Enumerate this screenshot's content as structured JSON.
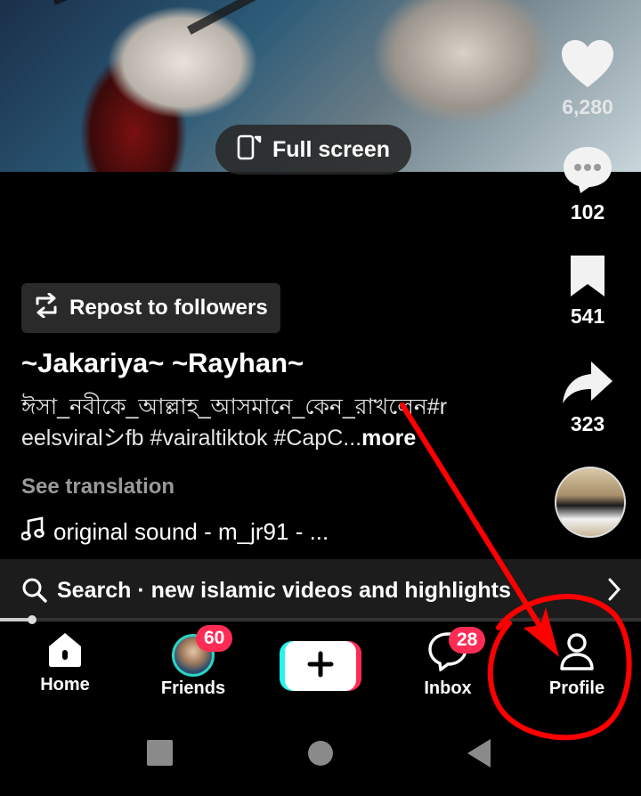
{
  "video": {
    "fullscreen_label": "Full screen"
  },
  "rail": {
    "likes": "6,280",
    "comments": "102",
    "saves": "541",
    "shares": "323"
  },
  "post": {
    "repost_label": "Repost to followers",
    "author": "~Jakariya~ ~Rayhan~",
    "caption_line1": "ঈসা_নবীকে_আল্লাহ_আসমানে_কেন_রাখলেন#r",
    "caption_line2": "eelsviralシfb #vairaltiktok #CapC...",
    "more_label": "more",
    "see_translation": "See translation",
    "sound": "original sound - m_jr91 - ..."
  },
  "search": {
    "text": "Search · new islamic videos and highlights"
  },
  "progress": {
    "fraction": 0.05
  },
  "nav": {
    "home": "Home",
    "friends": "Friends",
    "friends_badge": "60",
    "inbox": "Inbox",
    "inbox_badge": "28",
    "profile": "Profile"
  },
  "colors": {
    "accent_red": "#fe2c55",
    "accent_cyan": "#25f4ee",
    "annotation_red": "#ff0000"
  }
}
